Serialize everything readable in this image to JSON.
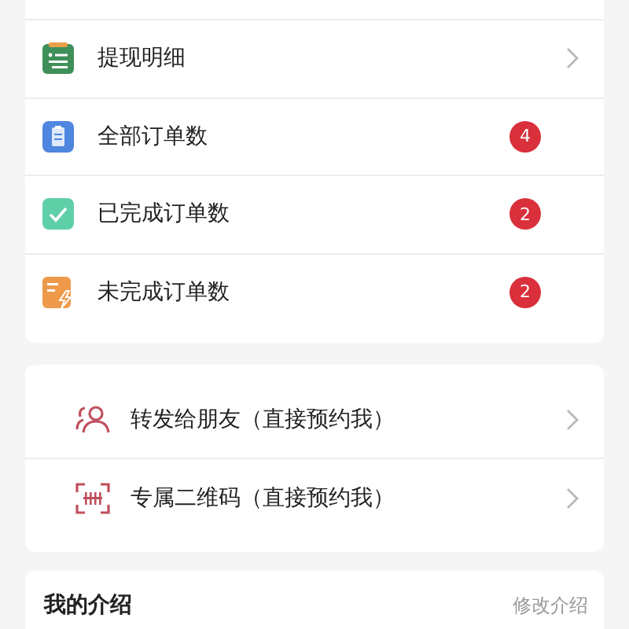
{
  "stats_card": {
    "rows": [
      {
        "label": "提现明细",
        "kind": "link"
      },
      {
        "label": "全部订单数",
        "kind": "count",
        "badge": "4"
      },
      {
        "label": "已完成订单数",
        "kind": "count",
        "badge": "2"
      },
      {
        "label": "未完成订单数",
        "kind": "count",
        "badge": "2"
      }
    ]
  },
  "share_card": {
    "rows": [
      {
        "label": "转发给朋友（直接预约我）",
        "kind": "link"
      },
      {
        "label": "专属二维码（直接预约我）",
        "kind": "link"
      }
    ]
  },
  "intro_card": {
    "title": "我的介绍",
    "action": "修改介绍"
  }
}
